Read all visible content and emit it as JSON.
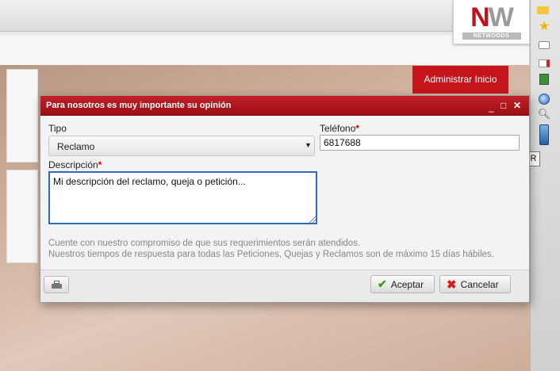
{
  "app": {
    "logo": {
      "letters_red": "N",
      "letters_gray": "W",
      "tagline": "NETWOODS"
    },
    "admin_button": "Administrar Inicio",
    "tooltip": "PQR"
  },
  "dialog": {
    "title": "Para nosotros es muy importante su opinión",
    "controls": {
      "minimize": "_",
      "maximize": "□",
      "close": "✕"
    },
    "fields": {
      "tipo": {
        "label": "Tipo",
        "value": "Reclamo"
      },
      "telefono": {
        "label": "Teléfono",
        "required_mark": "*",
        "value": "6817688"
      },
      "descripcion": {
        "label": "Descripción",
        "required_mark": "*",
        "value": "Mi descripción del reclamo, queja o petición..."
      }
    },
    "info_lines": [
      "Cuente con nuestro compromiso de que sus requerimientos serán atendidos.",
      "Nuestros tiempos de respuesta para todas las Peticiones, Quejas y Reclamos son de máximo 15 días hábiles."
    ],
    "buttons": {
      "accept": "Aceptar",
      "cancel": "Cancelar"
    }
  },
  "colors": {
    "brand_red": "#c4151c",
    "header_red": "#b0161c",
    "focus_blue": "#2f6bbd",
    "accept_green": "#3a9a1a"
  },
  "icons": [
    "folder-icon",
    "star-icon",
    "chat-icon",
    "mail-icon",
    "calculator-icon",
    "globe-icon",
    "search-icon",
    "pqr-icon",
    "print-icon",
    "check-icon",
    "x-icon"
  ]
}
